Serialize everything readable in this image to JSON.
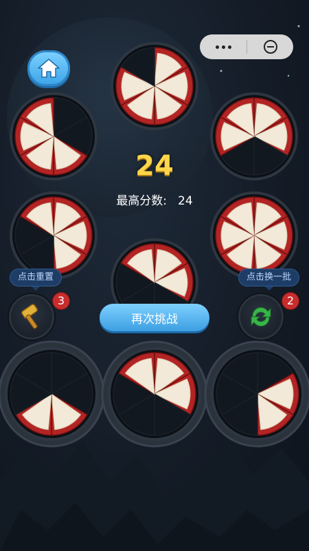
{
  "score": "24",
  "best_score": {
    "label": "最高分数:",
    "value": "24"
  },
  "buttons": {
    "retry": "再次挑战",
    "reset_tip": "点击重置",
    "swap_tip": "点击换一批",
    "hammer_count": "3",
    "swap_count": "2"
  },
  "icons": {
    "home": "home-icon",
    "capsule_more": "more-dots-icon",
    "capsule_close": "minimize-circle-icon",
    "hammer": "hammer-icon",
    "swap": "refresh-arrows-icon"
  },
  "colors": {
    "accent_blue": "#3aa3e8",
    "score_gold": "#ffd64a",
    "rim_red": "#b32424",
    "slice_cream": "#f2e9d8",
    "badge_red": "#c82d2d"
  },
  "wheels": [
    {
      "id": "top-center",
      "filled": [
        0,
        1,
        2,
        3,
        4
      ]
    },
    {
      "id": "left-upper",
      "filled": [
        2,
        3,
        4,
        5
      ]
    },
    {
      "id": "right-upper",
      "filled": [
        0,
        1,
        4,
        5
      ]
    },
    {
      "id": "left-middle",
      "filled": [
        0,
        1,
        2,
        5
      ]
    },
    {
      "id": "right-middle",
      "filled": [
        0,
        1,
        2,
        3,
        4,
        5
      ]
    },
    {
      "id": "center-lower",
      "filled": [
        0,
        1,
        5
      ]
    },
    {
      "id": "bottom-left",
      "filled": [
        2,
        3
      ]
    },
    {
      "id": "bottom-center",
      "filled": [
        0,
        1,
        5
      ]
    },
    {
      "id": "bottom-right",
      "filled": [
        1,
        2
      ]
    }
  ]
}
